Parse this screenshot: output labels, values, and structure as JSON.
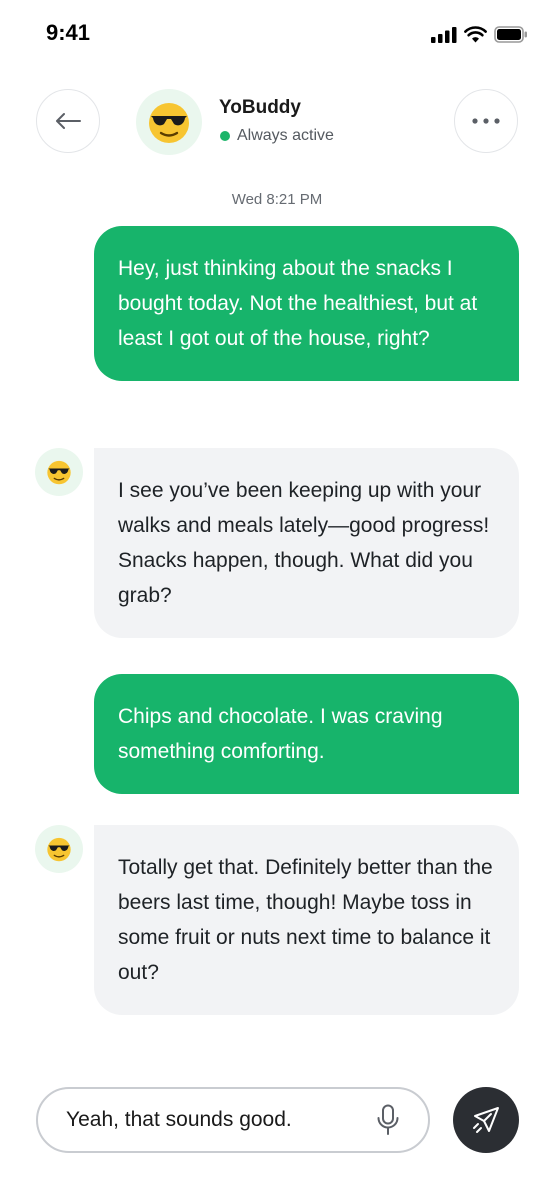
{
  "status_bar": {
    "time": "9:41"
  },
  "header": {
    "back_icon": "arrow-left-icon",
    "name": "YoBuddy",
    "status": "Always active",
    "status_color": "#1db56a",
    "more_icon": "more-horizontal-icon"
  },
  "conversation": {
    "timestamp": "Wed 8:21 PM",
    "messages": [
      {
        "sender": "user",
        "text": "Hey, just thinking about the snacks I bought today. Not the healthiest, but at least I got out of the house, right?"
      },
      {
        "sender": "bot",
        "text": "I see you’ve been keeping up with your walks and meals lately—good progress! Snacks happen, though. What did you grab?"
      },
      {
        "sender": "user",
        "text": "Chips and chocolate. I was craving something comforting."
      },
      {
        "sender": "bot",
        "text": "Totally get that. Definitely better than the beers last time, though! Maybe toss in some fruit or nuts next time to balance it out?"
      }
    ]
  },
  "composer": {
    "value": "Yeah, that sounds good.",
    "mic_icon": "microphone-icon",
    "send_icon": "send-icon"
  },
  "colors": {
    "accent": "#17b46b",
    "bot_bubble": "#f2f3f5",
    "send_button": "#2b2e33"
  }
}
